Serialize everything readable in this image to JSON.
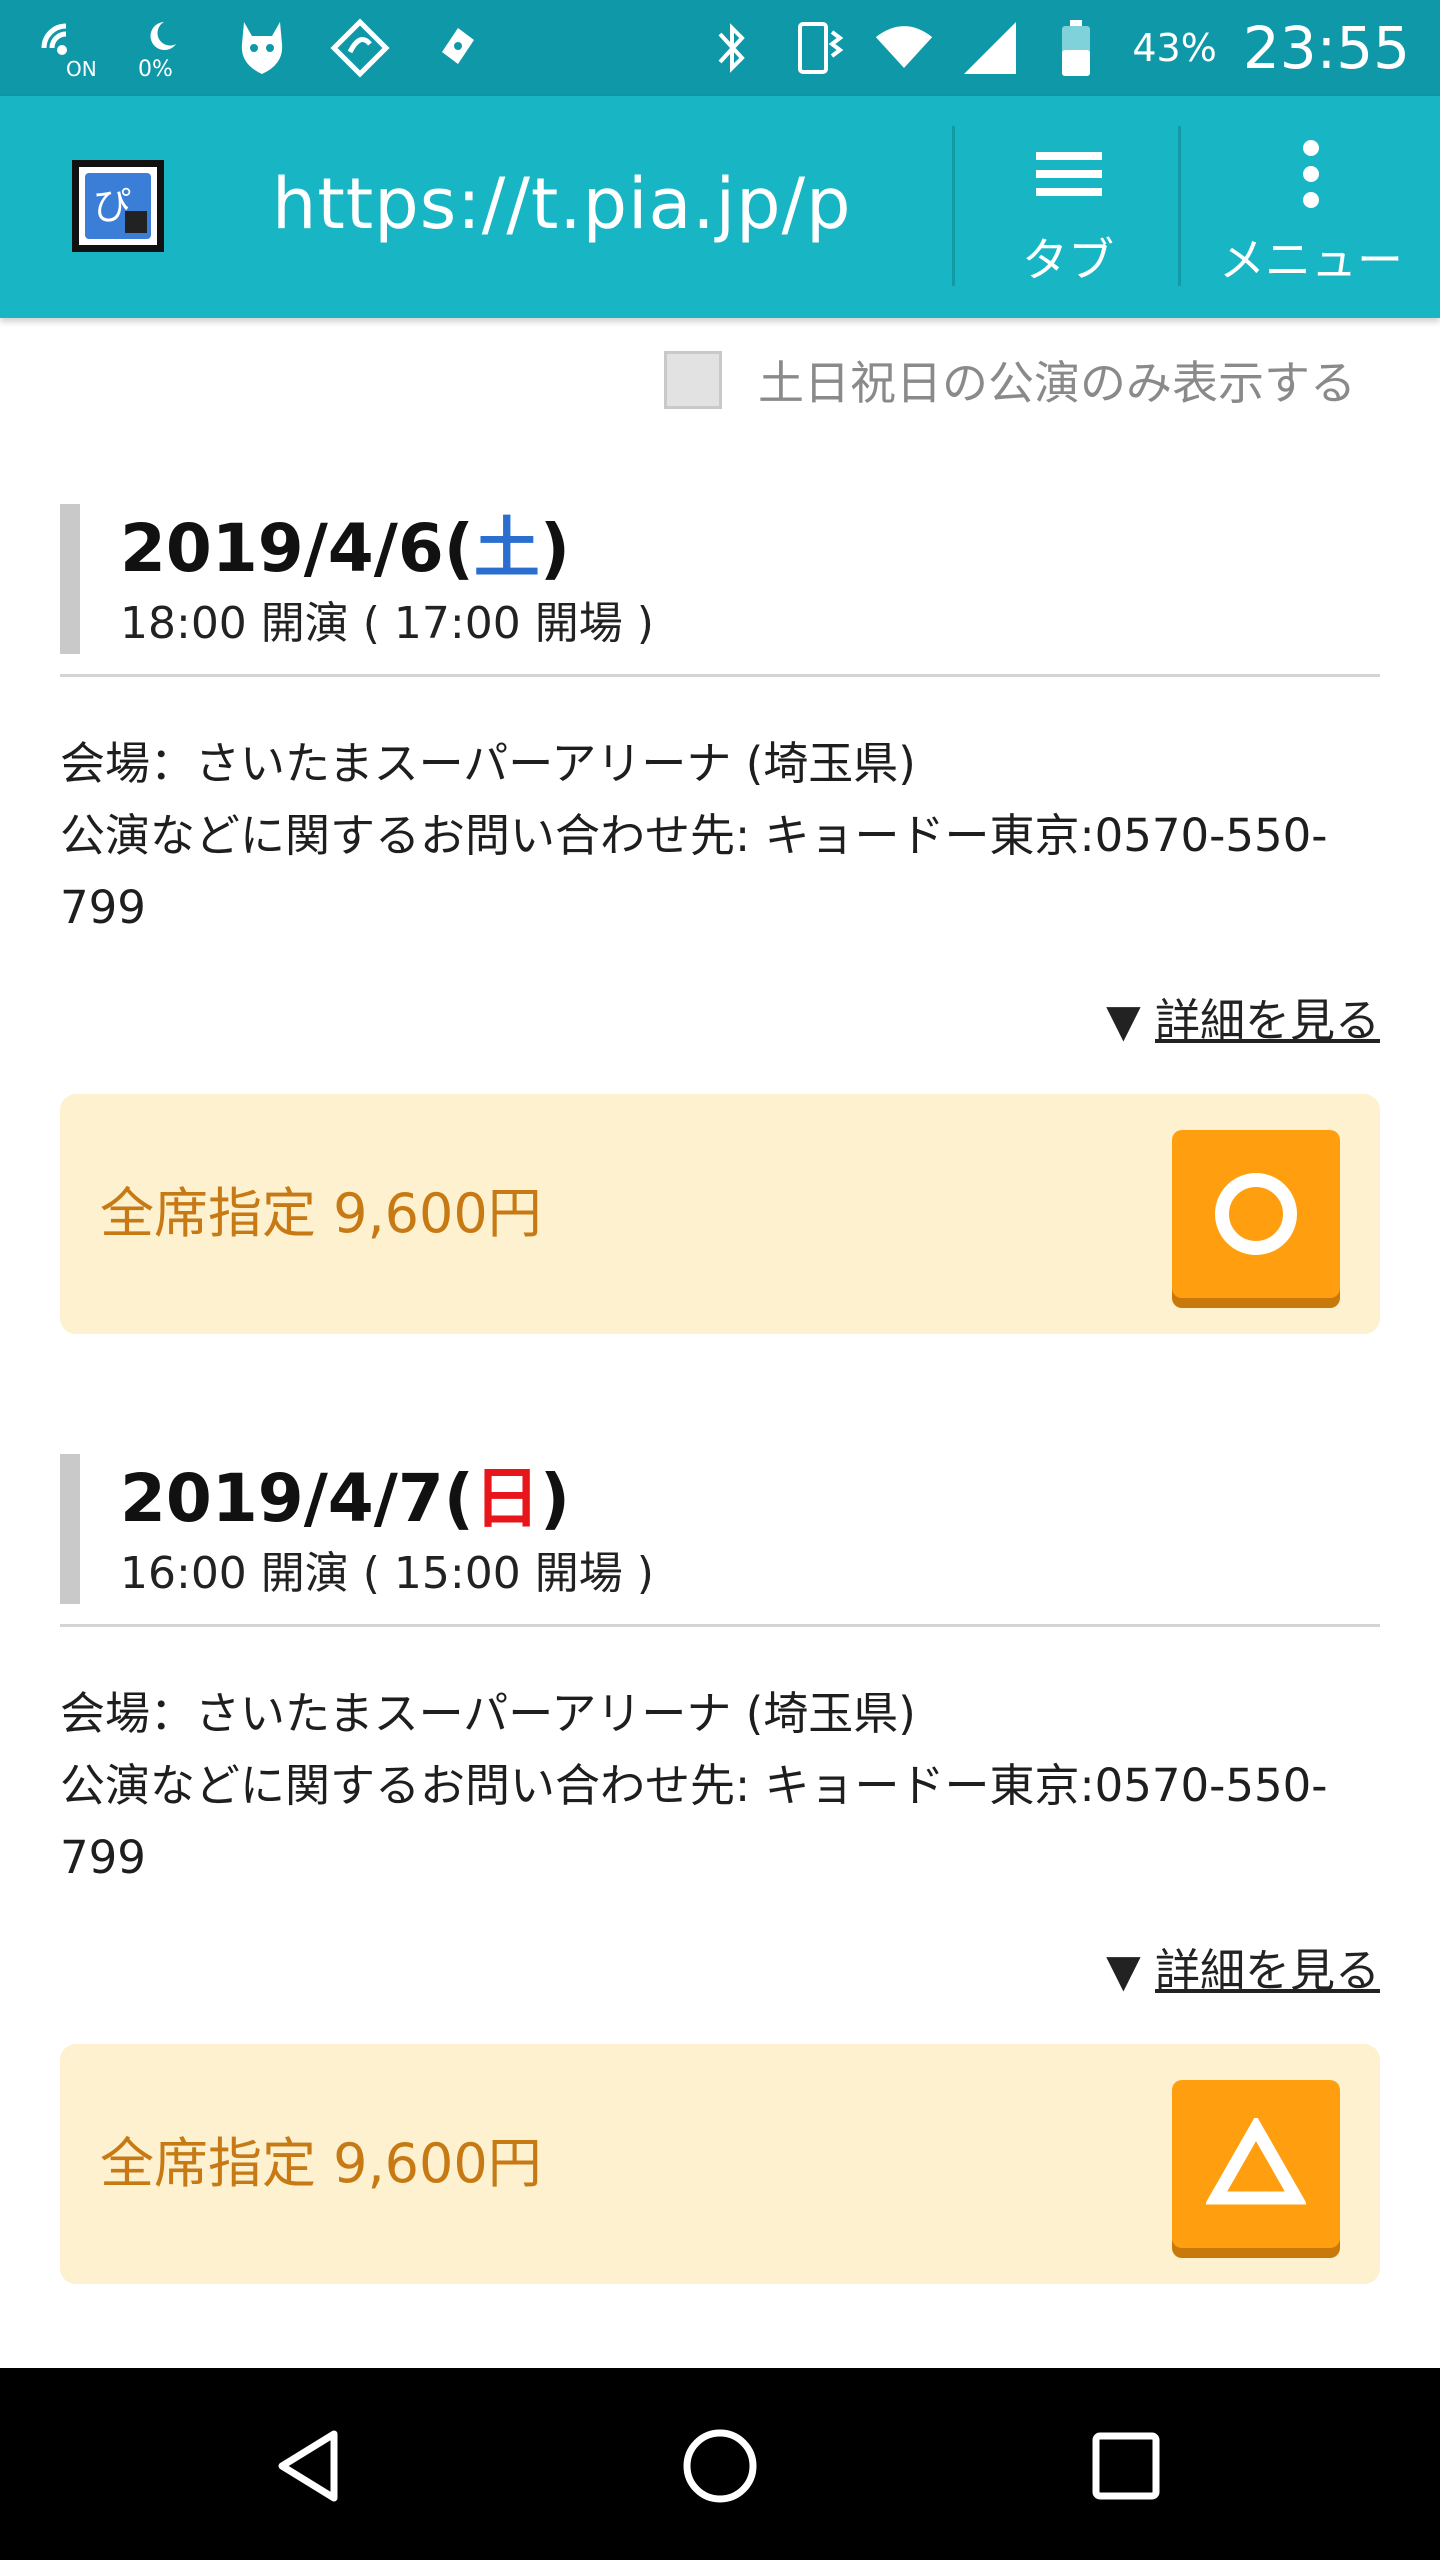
{
  "status_bar": {
    "left_icons": [
      "volte-on-icon",
      "data-saver-icon",
      "dog-app-icon",
      "sync-app-icon",
      "ticket-app-icon"
    ],
    "volte_text": "ON",
    "data_text": "0%",
    "battery_percent": "43%",
    "time": "23:55"
  },
  "browser": {
    "url": "https://t.pia.jp/pia",
    "tab_label": "タブ",
    "menu_label": "メニュー"
  },
  "filter": {
    "checkbox_label": "土日祝日の公演のみ表示する",
    "checked": false
  },
  "events": [
    {
      "date_prefix": "2019/4/6(",
      "day": "土",
      "day_color": "#2a6fd0",
      "date_suffix": ")",
      "time": "18:00 開演 ( 17:00 開場 )",
      "venue": "会場：さいたまスーパーアリーナ (埼玉県)",
      "contact": "公演などに関するお問い合わせ先: キョードー東京:0570-550-799",
      "details_arrow": "▼",
      "details_link": "詳細を見る",
      "ticket_label": "全席指定 9,600円",
      "availability": "circle"
    },
    {
      "date_prefix": "2019/4/7(",
      "day": "日",
      "day_color": "#e8161b",
      "date_suffix": ")",
      "time": "16:00 開演 ( 15:00 開場 )",
      "venue": "会場：さいたまスーパーアリーナ (埼玉県)",
      "contact": "公演などに関するお問い合わせ先: キョードー東京:0570-550-799",
      "details_arrow": "▼",
      "details_link": "詳細を見る",
      "ticket_label": "全席指定 9,600円",
      "availability": "triangle"
    }
  ],
  "nav": {
    "back": "back-icon",
    "home": "home-icon",
    "recents": "recents-icon"
  }
}
